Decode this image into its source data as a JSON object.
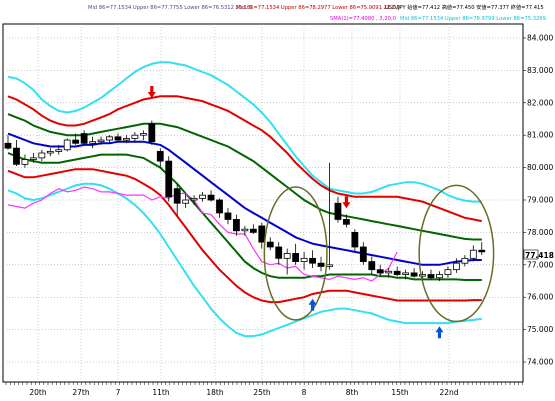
{
  "chart_data": {
    "type": "candlestick",
    "legend": {
      "row1": [
        {
          "text": "Mid 86=77.1534 Upper 86=77.7755 Lower 86=76.5312  21,1.0",
          "color": "#4a4a8a"
        },
        {
          "text": "Mid 86=77.1534 Upper 86=78.2977 Lower 86=75.9091  21,2.0",
          "color": "#c00000"
        },
        {
          "text": "USD/JPY 始値=77.412 高値=77.450 安値=77.377 終値=77.415",
          "color": "#000000"
        }
      ],
      "row2": [
        {
          "text": "SMA(1)=77.4080 , 3,20,0",
          "color": "#e000e0"
        },
        {
          "text": "Mid 86=77.1534 Upper 86=78.9799 Lower 86=75.3269",
          "color": "#00c8e0"
        }
      ]
    },
    "y_ticks": [
      "84.000",
      "83.000",
      "82.000",
      "81.000",
      "80.000",
      "79.000",
      "78.000",
      "77.000",
      "76.000",
      "75.000",
      "74.000"
    ],
    "ylim": [
      73.6,
      84.4
    ],
    "x_ticks": [
      "20th",
      "27th",
      "7",
      "11th",
      "18th",
      "25th",
      "8",
      "8th",
      "15th",
      "22nd"
    ],
    "last_price_label": "77.418",
    "candles": [
      {
        "o": 80.75,
        "h": 81.0,
        "l": 80.55,
        "c": 80.6
      },
      {
        "o": 80.6,
        "h": 80.85,
        "l": 80.05,
        "c": 80.1
      },
      {
        "o": 80.1,
        "h": 80.4,
        "l": 80.0,
        "c": 80.25
      },
      {
        "o": 80.25,
        "h": 80.45,
        "l": 80.15,
        "c": 80.3
      },
      {
        "o": 80.3,
        "h": 80.55,
        "l": 80.2,
        "c": 80.45
      },
      {
        "o": 80.45,
        "h": 80.6,
        "l": 80.35,
        "c": 80.5
      },
      {
        "o": 80.5,
        "h": 80.7,
        "l": 80.4,
        "c": 80.55
      },
      {
        "o": 80.55,
        "h": 80.9,
        "l": 80.5,
        "c": 80.85
      },
      {
        "o": 80.85,
        "h": 81.05,
        "l": 80.7,
        "c": 80.75
      },
      {
        "o": 81.05,
        "h": 81.15,
        "l": 80.7,
        "c": 80.75
      },
      {
        "o": 80.75,
        "h": 80.95,
        "l": 80.6,
        "c": 80.8
      },
      {
        "o": 80.8,
        "h": 80.95,
        "l": 80.7,
        "c": 80.85
      },
      {
        "o": 80.85,
        "h": 81.0,
        "l": 80.75,
        "c": 80.95
      },
      {
        "o": 80.95,
        "h": 81.05,
        "l": 80.8,
        "c": 80.85
      },
      {
        "o": 80.85,
        "h": 81.0,
        "l": 80.75,
        "c": 80.9
      },
      {
        "o": 80.9,
        "h": 81.1,
        "l": 80.8,
        "c": 81.0
      },
      {
        "o": 81.0,
        "h": 81.15,
        "l": 80.85,
        "c": 81.05
      },
      {
        "o": 81.35,
        "h": 81.45,
        "l": 80.7,
        "c": 80.8
      },
      {
        "o": 80.5,
        "h": 80.6,
        "l": 80.0,
        "c": 80.2
      },
      {
        "o": 80.2,
        "h": 80.35,
        "l": 78.95,
        "c": 79.1
      },
      {
        "o": 79.35,
        "h": 79.5,
        "l": 78.5,
        "c": 78.9
      },
      {
        "o": 78.9,
        "h": 79.2,
        "l": 78.75,
        "c": 79.0
      },
      {
        "o": 79.0,
        "h": 79.15,
        "l": 78.85,
        "c": 79.05
      },
      {
        "o": 79.05,
        "h": 79.25,
        "l": 78.95,
        "c": 79.15
      },
      {
        "o": 79.15,
        "h": 79.3,
        "l": 78.95,
        "c": 79.0
      },
      {
        "o": 79.0,
        "h": 79.05,
        "l": 78.45,
        "c": 78.6
      },
      {
        "o": 78.6,
        "h": 78.75,
        "l": 78.25,
        "c": 78.4
      },
      {
        "o": 78.4,
        "h": 78.55,
        "l": 77.9,
        "c": 78.05
      },
      {
        "o": 78.05,
        "h": 78.2,
        "l": 77.9,
        "c": 78.1
      },
      {
        "o": 78.1,
        "h": 78.25,
        "l": 77.95,
        "c": 78.0
      },
      {
        "o": 78.2,
        "h": 78.3,
        "l": 77.5,
        "c": 77.7
      },
      {
        "o": 77.7,
        "h": 77.85,
        "l": 77.45,
        "c": 77.55
      },
      {
        "o": 77.55,
        "h": 77.7,
        "l": 77.0,
        "c": 77.2
      },
      {
        "o": 77.2,
        "h": 77.5,
        "l": 76.7,
        "c": 77.35
      },
      {
        "o": 77.35,
        "h": 77.65,
        "l": 77.0,
        "c": 77.1
      },
      {
        "o": 77.1,
        "h": 77.4,
        "l": 76.85,
        "c": 77.2
      },
      {
        "o": 77.2,
        "h": 77.45,
        "l": 76.9,
        "c": 77.05
      },
      {
        "o": 77.05,
        "h": 77.25,
        "l": 76.8,
        "c": 76.95
      },
      {
        "o": 76.95,
        "h": 80.15,
        "l": 76.85,
        "c": 77.0
      },
      {
        "o": 78.9,
        "h": 79.1,
        "l": 78.3,
        "c": 78.4
      },
      {
        "o": 78.4,
        "h": 78.55,
        "l": 78.15,
        "c": 78.25
      },
      {
        "o": 78.0,
        "h": 78.1,
        "l": 77.4,
        "c": 77.55
      },
      {
        "o": 77.55,
        "h": 77.7,
        "l": 77.0,
        "c": 77.1
      },
      {
        "o": 77.1,
        "h": 77.25,
        "l": 76.7,
        "c": 76.85
      },
      {
        "o": 76.85,
        "h": 77.0,
        "l": 76.65,
        "c": 76.75
      },
      {
        "o": 76.75,
        "h": 76.9,
        "l": 76.6,
        "c": 76.8
      },
      {
        "o": 76.8,
        "h": 76.95,
        "l": 76.65,
        "c": 76.7
      },
      {
        "o": 76.7,
        "h": 76.85,
        "l": 76.55,
        "c": 76.75
      },
      {
        "o": 76.75,
        "h": 76.9,
        "l": 76.6,
        "c": 76.65
      },
      {
        "o": 76.65,
        "h": 76.8,
        "l": 76.5,
        "c": 76.7
      },
      {
        "o": 76.7,
        "h": 76.85,
        "l": 76.55,
        "c": 76.6
      },
      {
        "o": 76.6,
        "h": 76.8,
        "l": 76.5,
        "c": 76.7
      },
      {
        "o": 76.7,
        "h": 76.95,
        "l": 76.6,
        "c": 76.85
      },
      {
        "o": 76.85,
        "h": 77.2,
        "l": 76.75,
        "c": 77.05
      },
      {
        "o": 77.05,
        "h": 77.3,
        "l": 76.95,
        "c": 77.2
      },
      {
        "o": 77.2,
        "h": 77.6,
        "l": 77.1,
        "c": 77.45
      },
      {
        "o": 77.45,
        "h": 77.7,
        "l": 77.3,
        "c": 77.4
      }
    ],
    "bands": [
      {
        "name": "upper-3sigma",
        "color": "#33e0f0",
        "values": [
          82.8,
          82.75,
          82.6,
          82.4,
          82.1,
          81.9,
          81.75,
          81.7,
          81.75,
          81.85,
          82.0,
          82.15,
          82.35,
          82.55,
          82.75,
          82.95,
          83.1,
          83.2,
          83.25,
          83.25,
          83.2,
          83.15,
          83.05,
          82.95,
          82.85,
          82.7,
          82.55,
          82.35,
          82.15,
          81.95,
          81.7,
          81.4,
          81.05,
          80.7,
          80.35,
          80.05,
          79.75,
          79.55,
          79.35,
          79.3,
          79.25,
          79.2,
          79.2,
          79.25,
          79.35,
          79.45,
          79.5,
          79.55,
          79.55,
          79.5,
          79.4,
          79.3,
          79.15,
          79.05,
          78.98,
          78.95,
          78.95
        ]
      },
      {
        "name": "upper-2sigma",
        "color": "#e00000",
        "values": [
          82.2,
          82.1,
          81.95,
          81.8,
          81.6,
          81.45,
          81.35,
          81.3,
          81.3,
          81.35,
          81.45,
          81.55,
          81.65,
          81.8,
          81.9,
          82.0,
          82.1,
          82.15,
          82.2,
          82.2,
          82.2,
          82.15,
          82.1,
          82.05,
          81.95,
          81.85,
          81.75,
          81.6,
          81.45,
          81.3,
          81.15,
          80.95,
          80.7,
          80.45,
          80.15,
          79.9,
          79.65,
          79.45,
          79.3,
          79.2,
          79.15,
          79.1,
          79.1,
          79.1,
          79.1,
          79.1,
          79.1,
          79.05,
          79.0,
          78.95,
          78.85,
          78.75,
          78.65,
          78.55,
          78.45,
          78.4,
          78.35
        ]
      },
      {
        "name": "upper-1sigma",
        "color": "#006400",
        "values": [
          81.65,
          81.55,
          81.45,
          81.3,
          81.2,
          81.1,
          81.05,
          81.0,
          81.0,
          81.0,
          81.05,
          81.1,
          81.15,
          81.2,
          81.25,
          81.3,
          81.35,
          81.35,
          81.35,
          81.3,
          81.25,
          81.15,
          81.05,
          80.95,
          80.85,
          80.75,
          80.65,
          80.5,
          80.35,
          80.2,
          80.0,
          79.8,
          79.6,
          79.4,
          79.2,
          79.0,
          78.85,
          78.7,
          78.6,
          78.55,
          78.5,
          78.45,
          78.4,
          78.35,
          78.3,
          78.25,
          78.2,
          78.15,
          78.1,
          78.05,
          78.0,
          77.95,
          77.9,
          77.85,
          77.8,
          77.78,
          77.78
        ]
      },
      {
        "name": "middle",
        "color": "#0000cc",
        "values": [
          81.05,
          80.95,
          80.85,
          80.75,
          80.7,
          80.65,
          80.65,
          80.65,
          80.65,
          80.7,
          80.7,
          80.75,
          80.75,
          80.8,
          80.8,
          80.8,
          80.8,
          80.75,
          80.7,
          80.55,
          80.35,
          80.15,
          79.95,
          79.75,
          79.55,
          79.35,
          79.15,
          78.95,
          78.75,
          78.6,
          78.45,
          78.3,
          78.15,
          78.0,
          77.85,
          77.75,
          77.65,
          77.6,
          77.55,
          77.5,
          77.45,
          77.4,
          77.35,
          77.3,
          77.25,
          77.2,
          77.15,
          77.1,
          77.05,
          77.0,
          77.0,
          77.0,
          77.05,
          77.1,
          77.12,
          77.15,
          77.15
        ]
      },
      {
        "name": "lower-1sigma",
        "color": "#006400",
        "values": [
          80.45,
          80.35,
          80.25,
          80.2,
          80.15,
          80.15,
          80.15,
          80.2,
          80.25,
          80.3,
          80.35,
          80.4,
          80.4,
          80.4,
          80.4,
          80.35,
          80.3,
          80.15,
          80.0,
          79.75,
          79.5,
          79.2,
          78.9,
          78.6,
          78.3,
          78.0,
          77.7,
          77.4,
          77.1,
          76.9,
          76.75,
          76.65,
          76.6,
          76.6,
          76.6,
          76.6,
          76.65,
          76.65,
          76.7,
          76.7,
          76.7,
          76.7,
          76.7,
          76.7,
          76.65,
          76.65,
          76.6,
          76.6,
          76.55,
          76.55,
          76.55,
          76.55,
          76.55,
          76.55,
          76.53,
          76.53,
          76.53
        ]
      },
      {
        "name": "lower-2sigma",
        "color": "#e00000",
        "values": [
          79.9,
          79.8,
          79.7,
          79.7,
          79.75,
          79.8,
          79.85,
          79.9,
          79.95,
          79.95,
          79.95,
          79.9,
          79.85,
          79.8,
          79.75,
          79.65,
          79.5,
          79.35,
          79.15,
          78.85,
          78.5,
          78.15,
          77.8,
          77.45,
          77.15,
          76.85,
          76.6,
          76.35,
          76.15,
          76.0,
          75.9,
          75.85,
          75.85,
          75.9,
          75.95,
          76.0,
          76.1,
          76.15,
          76.2,
          76.2,
          76.2,
          76.15,
          76.1,
          76.05,
          76.0,
          75.95,
          75.9,
          75.9,
          75.9,
          75.9,
          75.9,
          75.9,
          75.9,
          75.9,
          75.9,
          75.91,
          75.91
        ]
      },
      {
        "name": "lower-3sigma",
        "color": "#33e0f0",
        "values": [
          79.3,
          79.2,
          79.05,
          79.0,
          79.05,
          79.15,
          79.25,
          79.35,
          79.45,
          79.5,
          79.5,
          79.45,
          79.35,
          79.2,
          79.05,
          78.85,
          78.6,
          78.3,
          77.95,
          77.55,
          77.15,
          76.75,
          76.35,
          76.0,
          75.65,
          75.35,
          75.1,
          74.9,
          74.8,
          74.8,
          74.85,
          74.95,
          75.05,
          75.15,
          75.25,
          75.35,
          75.45,
          75.55,
          75.6,
          75.65,
          75.65,
          75.6,
          75.55,
          75.5,
          75.4,
          75.3,
          75.25,
          75.2,
          75.2,
          75.2,
          75.2,
          75.2,
          75.2,
          75.25,
          75.27,
          75.3,
          75.33
        ]
      }
    ],
    "lagging_span": {
      "name": "SMA lagging",
      "color": "#ff33ff",
      "values": [
        78.85,
        78.8,
        78.75,
        78.9,
        79.0,
        79.2,
        79.35,
        79.25,
        79.3,
        79.4,
        79.35,
        79.25,
        79.25,
        79.2,
        79.15,
        79.15,
        79.15,
        79.0,
        79.1,
        79.05,
        79.2,
        79.2,
        79.0,
        78.6,
        78.55,
        78.25,
        78.0,
        77.95,
        77.95,
        77.5,
        77.1,
        77.0,
        77.05,
        76.9,
        76.95,
        76.7,
        76.65,
        76.6,
        76.55,
        76.65,
        76.6,
        76.55,
        76.6,
        76.5,
        76.7,
        76.9,
        77.4
      ]
    },
    "lagging_start_index": 0,
    "arrows": [
      {
        "index": 17,
        "price": 82.3,
        "direction": "down",
        "color": "#e00000"
      },
      {
        "index": 40,
        "price": 78.9,
        "direction": "down",
        "color": "#e00000"
      },
      {
        "index": 36,
        "price": 75.8,
        "direction": "up",
        "color": "#0055dd"
      },
      {
        "index": 51,
        "price": 74.95,
        "direction": "up",
        "color": "#0055dd"
      }
    ],
    "ellipses": [
      {
        "center_index": 34,
        "center_price": 77.35,
        "rx_bars": 3.7,
        "ry_price": 2.05,
        "color": "#6b6b2a"
      },
      {
        "center_index": 53,
        "center_price": 77.35,
        "rx_bars": 4.4,
        "ry_price": 2.1,
        "color": "#6b6b2a"
      }
    ]
  }
}
